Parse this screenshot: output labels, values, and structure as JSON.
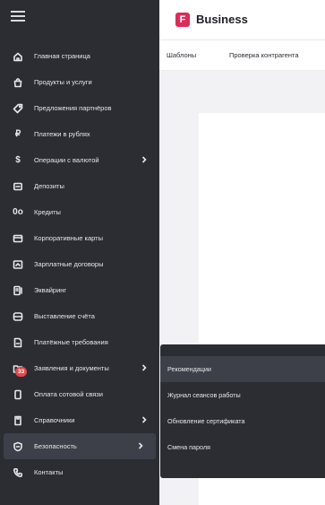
{
  "brand": {
    "logo_letter": "F",
    "name": "Business"
  },
  "subnav": {
    "items": [
      "Шаблоны",
      "Проверка контрагента"
    ]
  },
  "sidebar": {
    "items": [
      {
        "label": "Главная страница",
        "icon": "home-icon"
      },
      {
        "label": "Продукты и услуги",
        "icon": "bag-icon"
      },
      {
        "label": "Предложения партнёров",
        "icon": "tag-icon"
      },
      {
        "label": "Платежи в рублях",
        "icon": "ruble-icon"
      },
      {
        "label": "Операции с валютой",
        "icon": "dollar-icon",
        "chevron": true
      },
      {
        "label": "Депозиты",
        "icon": "deposit-icon"
      },
      {
        "label": "Кредиты",
        "icon": "credit-icon"
      },
      {
        "label": "Корпоративные карты",
        "icon": "card-icon"
      },
      {
        "label": "Зарплатные договоры",
        "icon": "salary-icon"
      },
      {
        "label": "Эквайринг",
        "icon": "acquiring-icon"
      },
      {
        "label": "Выставление счёта",
        "icon": "invoice-icon"
      },
      {
        "label": "Платёжные требования",
        "icon": "payment-request-icon"
      },
      {
        "label": "Заявления и документы",
        "icon": "documents-icon",
        "chevron": true,
        "badge": "33"
      },
      {
        "label": "Оплата сотовой связи",
        "icon": "phone-icon"
      },
      {
        "label": "Справочники",
        "icon": "directory-icon",
        "chevron": true
      },
      {
        "label": "Безопасность",
        "icon": "shield-icon",
        "chevron": true,
        "active": true
      },
      {
        "label": "Контакты",
        "icon": "contacts-icon"
      }
    ]
  },
  "flyout": {
    "items": [
      "Рекомендации",
      "Журнал сеансов работы",
      "Обновление сертификата",
      "Смена пароля"
    ],
    "highlighted_index": 0
  },
  "colors": {
    "sidebar": "#2b2d33",
    "active": "#3d4048",
    "brand": "#d92d5a",
    "badge": "#e5484d"
  }
}
